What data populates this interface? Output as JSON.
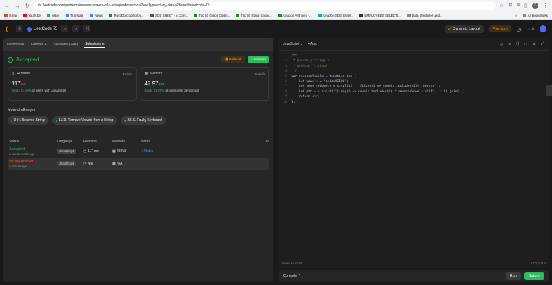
{
  "browser": {
    "url": "leetcode.com/problems/reverse-vowels-of-a-string/submissions/?envType=study-plan-v2&envId=leetcode-75",
    "avatar_letter": "Z",
    "bookmarks": [
      {
        "label": "Gmail",
        "color": "#ea4335"
      },
      {
        "label": "YouTube",
        "color": "#ff0000"
      },
      {
        "label": "Maps",
        "color": "#34a853"
      },
      {
        "label": "Translate",
        "color": "#4285f4"
      },
      {
        "label": "News",
        "color": "#4285f4"
      },
      {
        "label": "Must Do Coding Qu...",
        "color": "#2e7d32"
      },
      {
        "label": "SDE SHEET - A Com...",
        "color": "#555555"
      },
      {
        "label": "Top 50 Graph Codin...",
        "color": "#2e7d32"
      },
      {
        "label": "Top 50 String Codin...",
        "color": "#2e7d32"
      },
      {
        "label": "Amazon Archives -...",
        "color": "#2e7d32"
      },
      {
        "label": "Amazon SDE Sheet...",
        "color": "#4285f4"
      },
      {
        "label": "EMPLOYEES SELECTI...",
        "color": "#333333"
      },
      {
        "label": "Data structures and...",
        "color": "#888888"
      }
    ],
    "all_bookmarks": "All Bookmarks"
  },
  "lc": {
    "title": "LeetCode 75",
    "dynamic_layout": "Dynamic Layout",
    "premium": "Premium",
    "fire_count": "0"
  },
  "tabs": [
    "Description",
    "Editorial",
    "Solutions (6.4K)",
    "Submissions"
  ],
  "result": {
    "status": "Accepted",
    "editorial_btn": "Editorial",
    "solution_btn": "+ Solution"
  },
  "runtime": {
    "label": "Runtime",
    "details": "Details",
    "value": "117",
    "unit": "ms",
    "beats_pct": "Beats 21.69%",
    "beats_text": "of users with JavaScript"
  },
  "memory": {
    "label": "Memory",
    "details": "Details",
    "value": "47.97",
    "unit": "MB",
    "beats_pct": "Beats 71.65%",
    "beats_text": "of users with JavaScript"
  },
  "more_challenges": "More challenges",
  "challenges": [
    "344. Reverse String",
    "1119. Remove Vowels from a String",
    "2810. Faulty Keyboard"
  ],
  "table": {
    "headers": [
      "Status",
      "Language",
      "Runtime",
      "Memory",
      "Notes"
    ],
    "rows": [
      {
        "status": "Accepted",
        "when": "a few seconds ago",
        "lang": "JavaScript",
        "runtime": "117 ms",
        "memory": "48 MB",
        "notes": "+ Notes"
      },
      {
        "status": "Wrong Answer",
        "when": "a minute ago",
        "lang": "JavaScript",
        "runtime": "N/A",
        "memory": "N/A",
        "notes": ""
      }
    ]
  },
  "editor": {
    "language": "JavaScript",
    "mode": "Auto",
    "lines": [
      {
        "n": "1",
        "t": "/**",
        "c": true
      },
      {
        "n": "2",
        "t": " * @param {string} s",
        "c": true
      },
      {
        "n": "3",
        "t": " * @return {string}",
        "c": true
      },
      {
        "n": "4",
        "t": " */",
        "c": true
      },
      {
        "n": "5",
        "t": "var reverseVowels = function (s) {",
        "c": false
      },
      {
        "n": "6",
        "t": "    let vowels = \"aeiouAEIOU\";",
        "c": false
      },
      {
        "n": "7",
        "t": "    let reverseVowels = s.split('').filter(i => vowels.includes(i)).reverse();",
        "c": false
      },
      {
        "n": "8",
        "t": "    let str = s.split('').map(i => vowels.includes(i) ? reverseVowels.shift() : i).join('')",
        "c": false
      },
      {
        "n": "9",
        "t": "    return str;",
        "c": false
      },
      {
        "n": "10",
        "t": "};",
        "c": false
      }
    ],
    "saved": "Saved to local",
    "cursor": "Ln 10, Col 3"
  },
  "console": {
    "label": "Console",
    "run": "Run",
    "submit": "Submit"
  }
}
